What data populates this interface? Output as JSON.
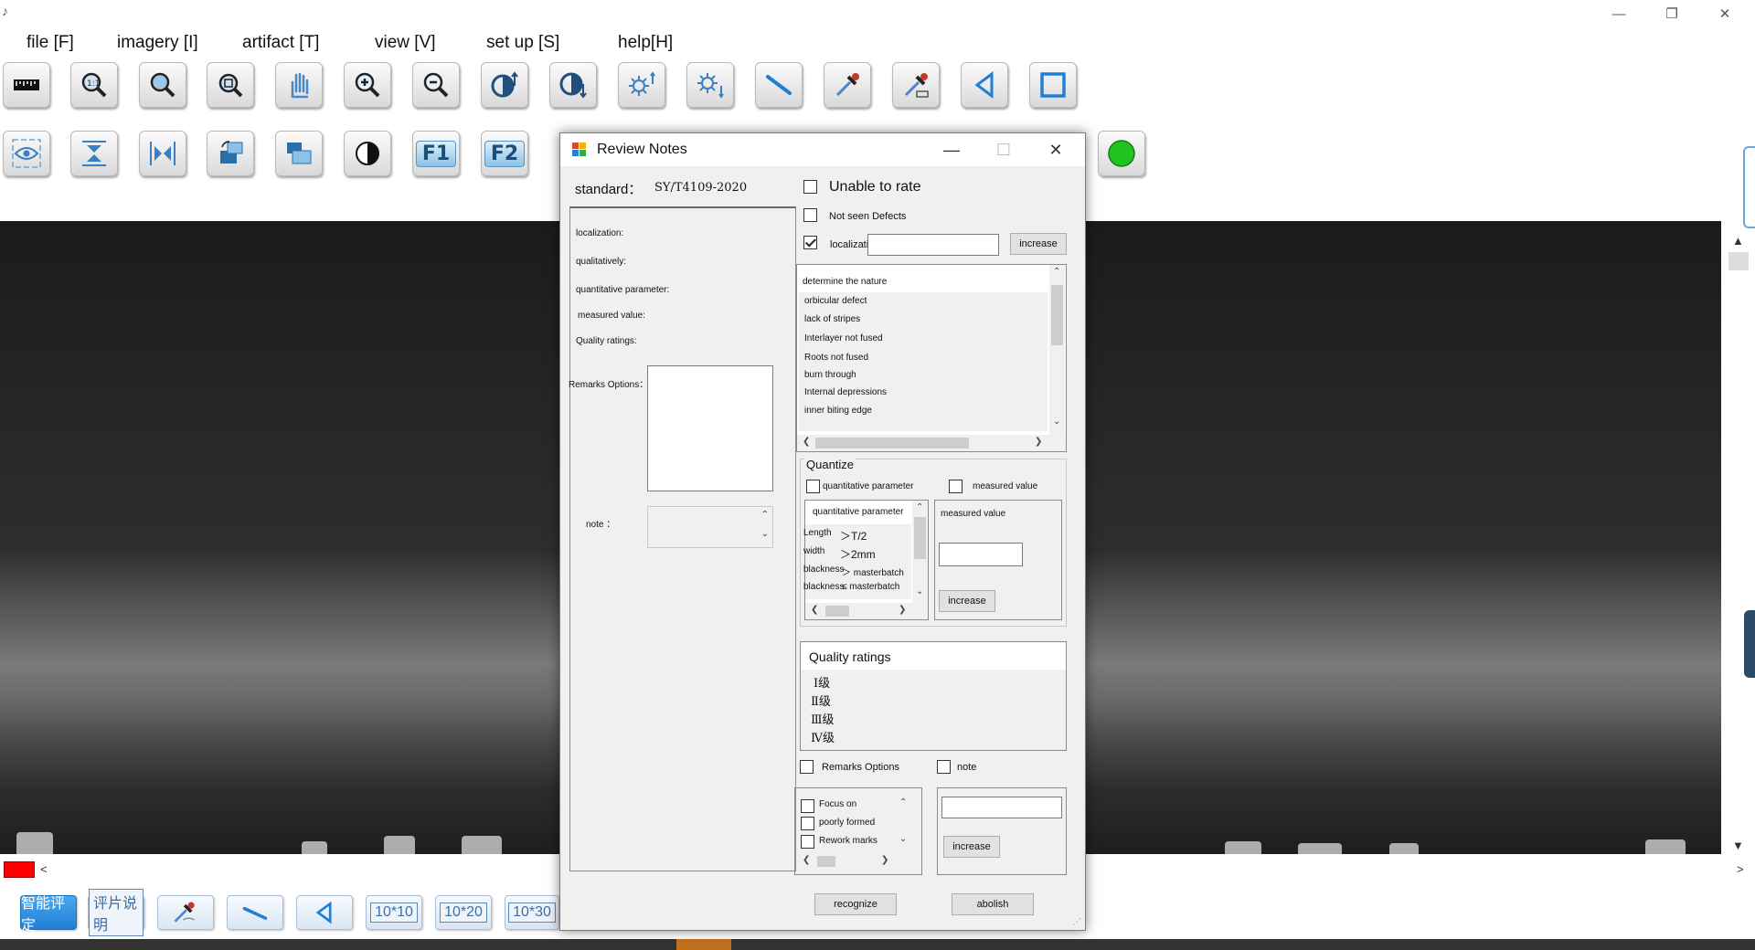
{
  "window": {
    "title_glyph": "♪",
    "controls": {
      "minimize": "—",
      "restore": "❐",
      "close": "✕"
    }
  },
  "menu": [
    {
      "label": "file  [F]"
    },
    {
      "label": "imagery  [I]"
    },
    {
      "label": "artifact  [T]"
    },
    {
      "label": "view  [V]"
    },
    {
      "label": "set up  [S]"
    },
    {
      "label": "help[H]"
    }
  ],
  "toolbar_row2": {
    "f1_label": "F1",
    "f2_label": "F2"
  },
  "bottom_toolbar": {
    "smart_rating": "智能评定",
    "film_description": "评片说明",
    "grid_10x10": "10*10",
    "grid_10x20": "10*20",
    "grid_10x30": "10*30"
  },
  "status": {
    "left_arrow": "<",
    "right_arrow": ">"
  },
  "colors": {
    "swatch": "#ff0000",
    "indicator": "#22c422"
  },
  "dialog": {
    "title": "Review Notes",
    "controls": {
      "minimize": "—",
      "maximize": "☐",
      "close": "✕"
    },
    "standard_label": "standard：",
    "standard_value": "SY/T4109-2020",
    "left": {
      "localization": "localization:",
      "qualitatively": "qualitatively:",
      "quantitative_parameter": "quantitative parameter:",
      "measured_value": "measured value:",
      "quality_ratings": "Quality ratings:",
      "remarks_options": "Remarks Options：",
      "note": "note ："
    },
    "unable_to_rate": "Unable to rate",
    "not_seen_defects": "Not seen Defects",
    "localization": {
      "label": "localization",
      "checked": true,
      "value": ""
    },
    "increase": "increase",
    "nature_list": {
      "header": "determine the nature",
      "items": [
        "orbicular defect",
        "lack of stripes",
        "Interlayer not fused",
        "Roots not fused",
        "burn through",
        "Internal depressions",
        "inner biting edge"
      ]
    },
    "quantize": {
      "title": "Quantize",
      "quantitative_parameter": "quantitative parameter",
      "measured_value": "measured value",
      "param_header": "quantitative parameter",
      "params": [
        {
          "name": "Length",
          "value": "＞T/2"
        },
        {
          "name": "width",
          "value": "＞2mm"
        },
        {
          "name": "blackness",
          "value": "＞  masterbatch"
        },
        {
          "name": "blackness",
          "value": "≤  masterbatch"
        }
      ],
      "measured_header": "measured value",
      "measured_input": "",
      "increase": "increase"
    },
    "quality": {
      "title": "Quality ratings",
      "grades": [
        "Ⅰ级",
        "Ⅱ级",
        "Ⅲ级",
        "Ⅳ级"
      ]
    },
    "remarks_checkbox": "Remarks Options",
    "note_checkbox": "note",
    "remarks": [
      "Focus on",
      "poorly formed",
      "Rework marks"
    ],
    "note_input": "",
    "note_increase": "increase",
    "recognize": "recognize",
    "abolish": "abolish"
  }
}
